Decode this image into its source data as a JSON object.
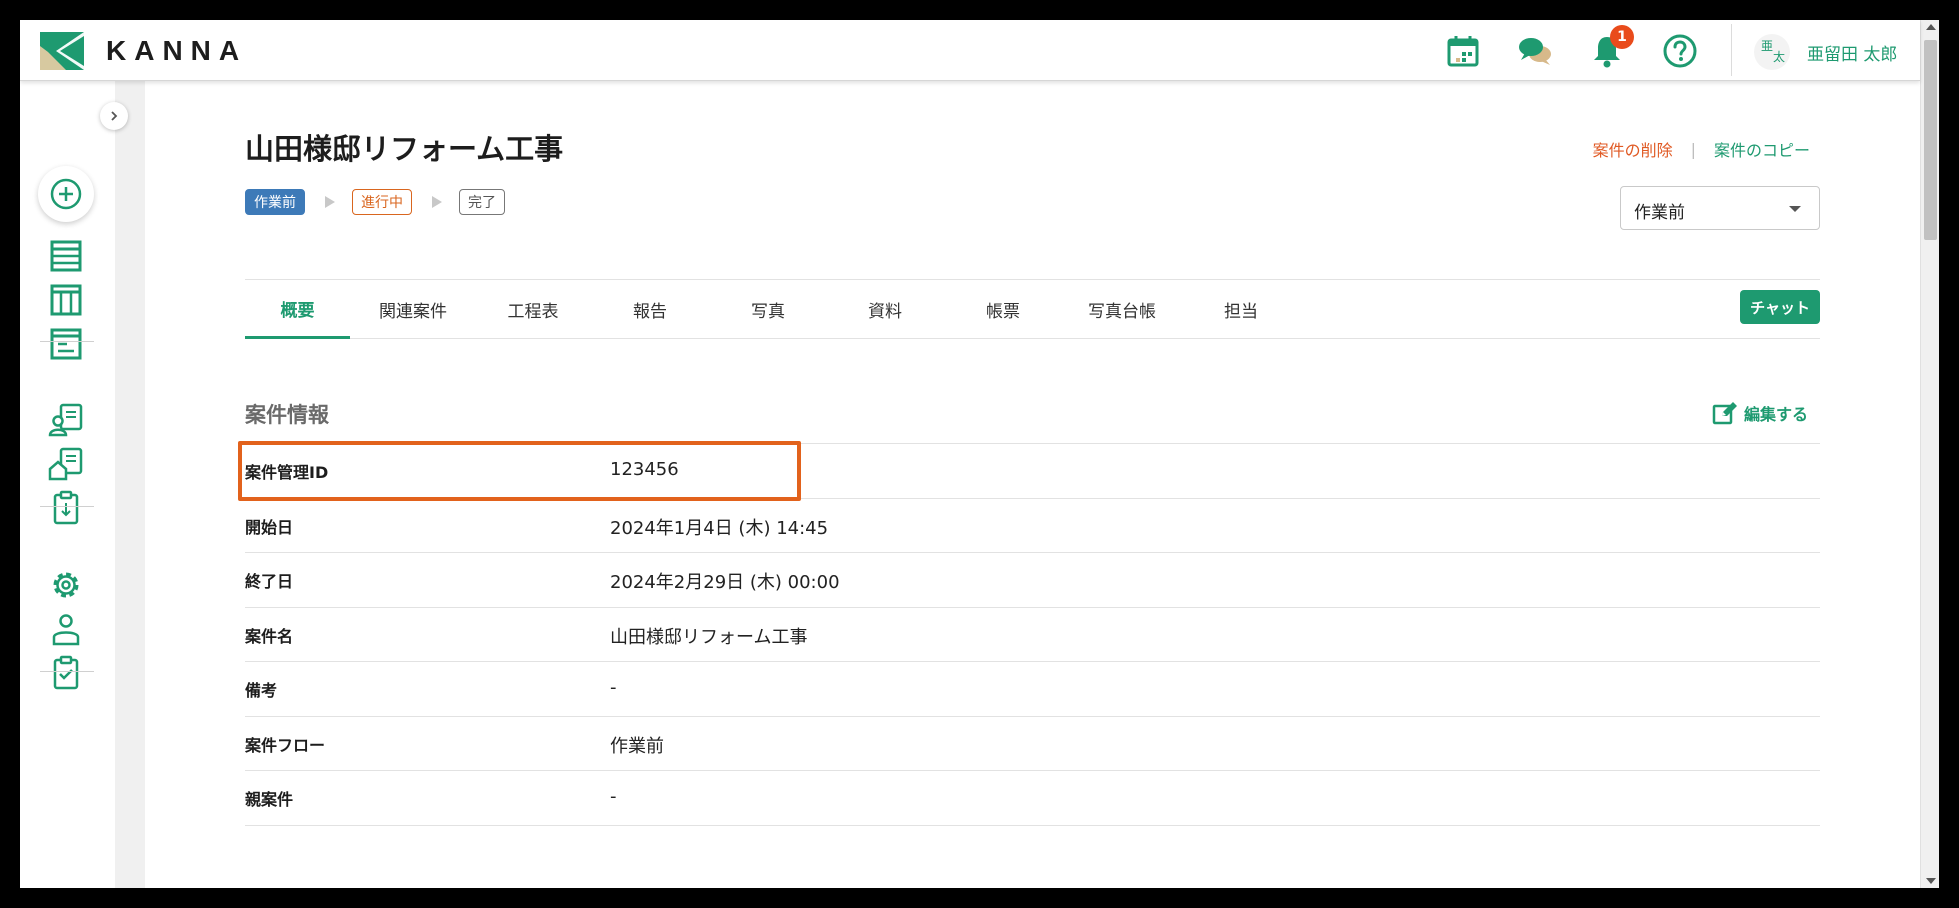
{
  "header": {
    "logo_text": "KANNA",
    "notification_count": "1",
    "avatar_chars": [
      "亜",
      "太"
    ],
    "user_name": "亜留田 太郎",
    "colors": {
      "brand_green": "#1e9a70",
      "badge": "#e94b1b"
    },
    "icons": [
      "calendar-icon",
      "chat-bubbles-icon",
      "bell-icon",
      "help-icon"
    ]
  },
  "sidebar": {
    "toggle_icon": "chevron-right-icon",
    "icons": [
      "add-circle-icon",
      "list-icon",
      "board-columns-icon",
      "document-icon",
      "customer-card-icon",
      "property-card-icon",
      "clipboard-download-icon",
      "gear-icon",
      "user-icon",
      "clipboard-check-icon"
    ]
  },
  "project": {
    "title": "山田様邸リフォーム工事",
    "delete_label": "案件の削除",
    "actions_separator": "|",
    "copy_label": "案件のコピー",
    "flow_steps": [
      "作業前",
      "進行中",
      "完了"
    ],
    "status_select_value": "作業前"
  },
  "tabs": [
    {
      "label": "概要",
      "active": true
    },
    {
      "label": "関連案件"
    },
    {
      "label": "工程表"
    },
    {
      "label": "報告"
    },
    {
      "label": "写真"
    },
    {
      "label": "資料"
    },
    {
      "label": "帳票"
    },
    {
      "label": "写真台帳"
    },
    {
      "label": "担当"
    }
  ],
  "chat_button_label": "チャット",
  "info": {
    "section_title": "案件情報",
    "edit_label": "編集する",
    "rows": [
      {
        "label": "案件管理ID",
        "value": "123456"
      },
      {
        "label": "開始日",
        "value": "2024年1月4日 (木) 14:45"
      },
      {
        "label": "終了日",
        "value": "2024年2月29日 (木) 00:00"
      },
      {
        "label": "案件名",
        "value": "山田様邸リフォーム工事"
      },
      {
        "label": "備考",
        "value": "-"
      },
      {
        "label": "案件フロー",
        "value": "作業前"
      },
      {
        "label": "親案件",
        "value": "-"
      }
    ]
  }
}
